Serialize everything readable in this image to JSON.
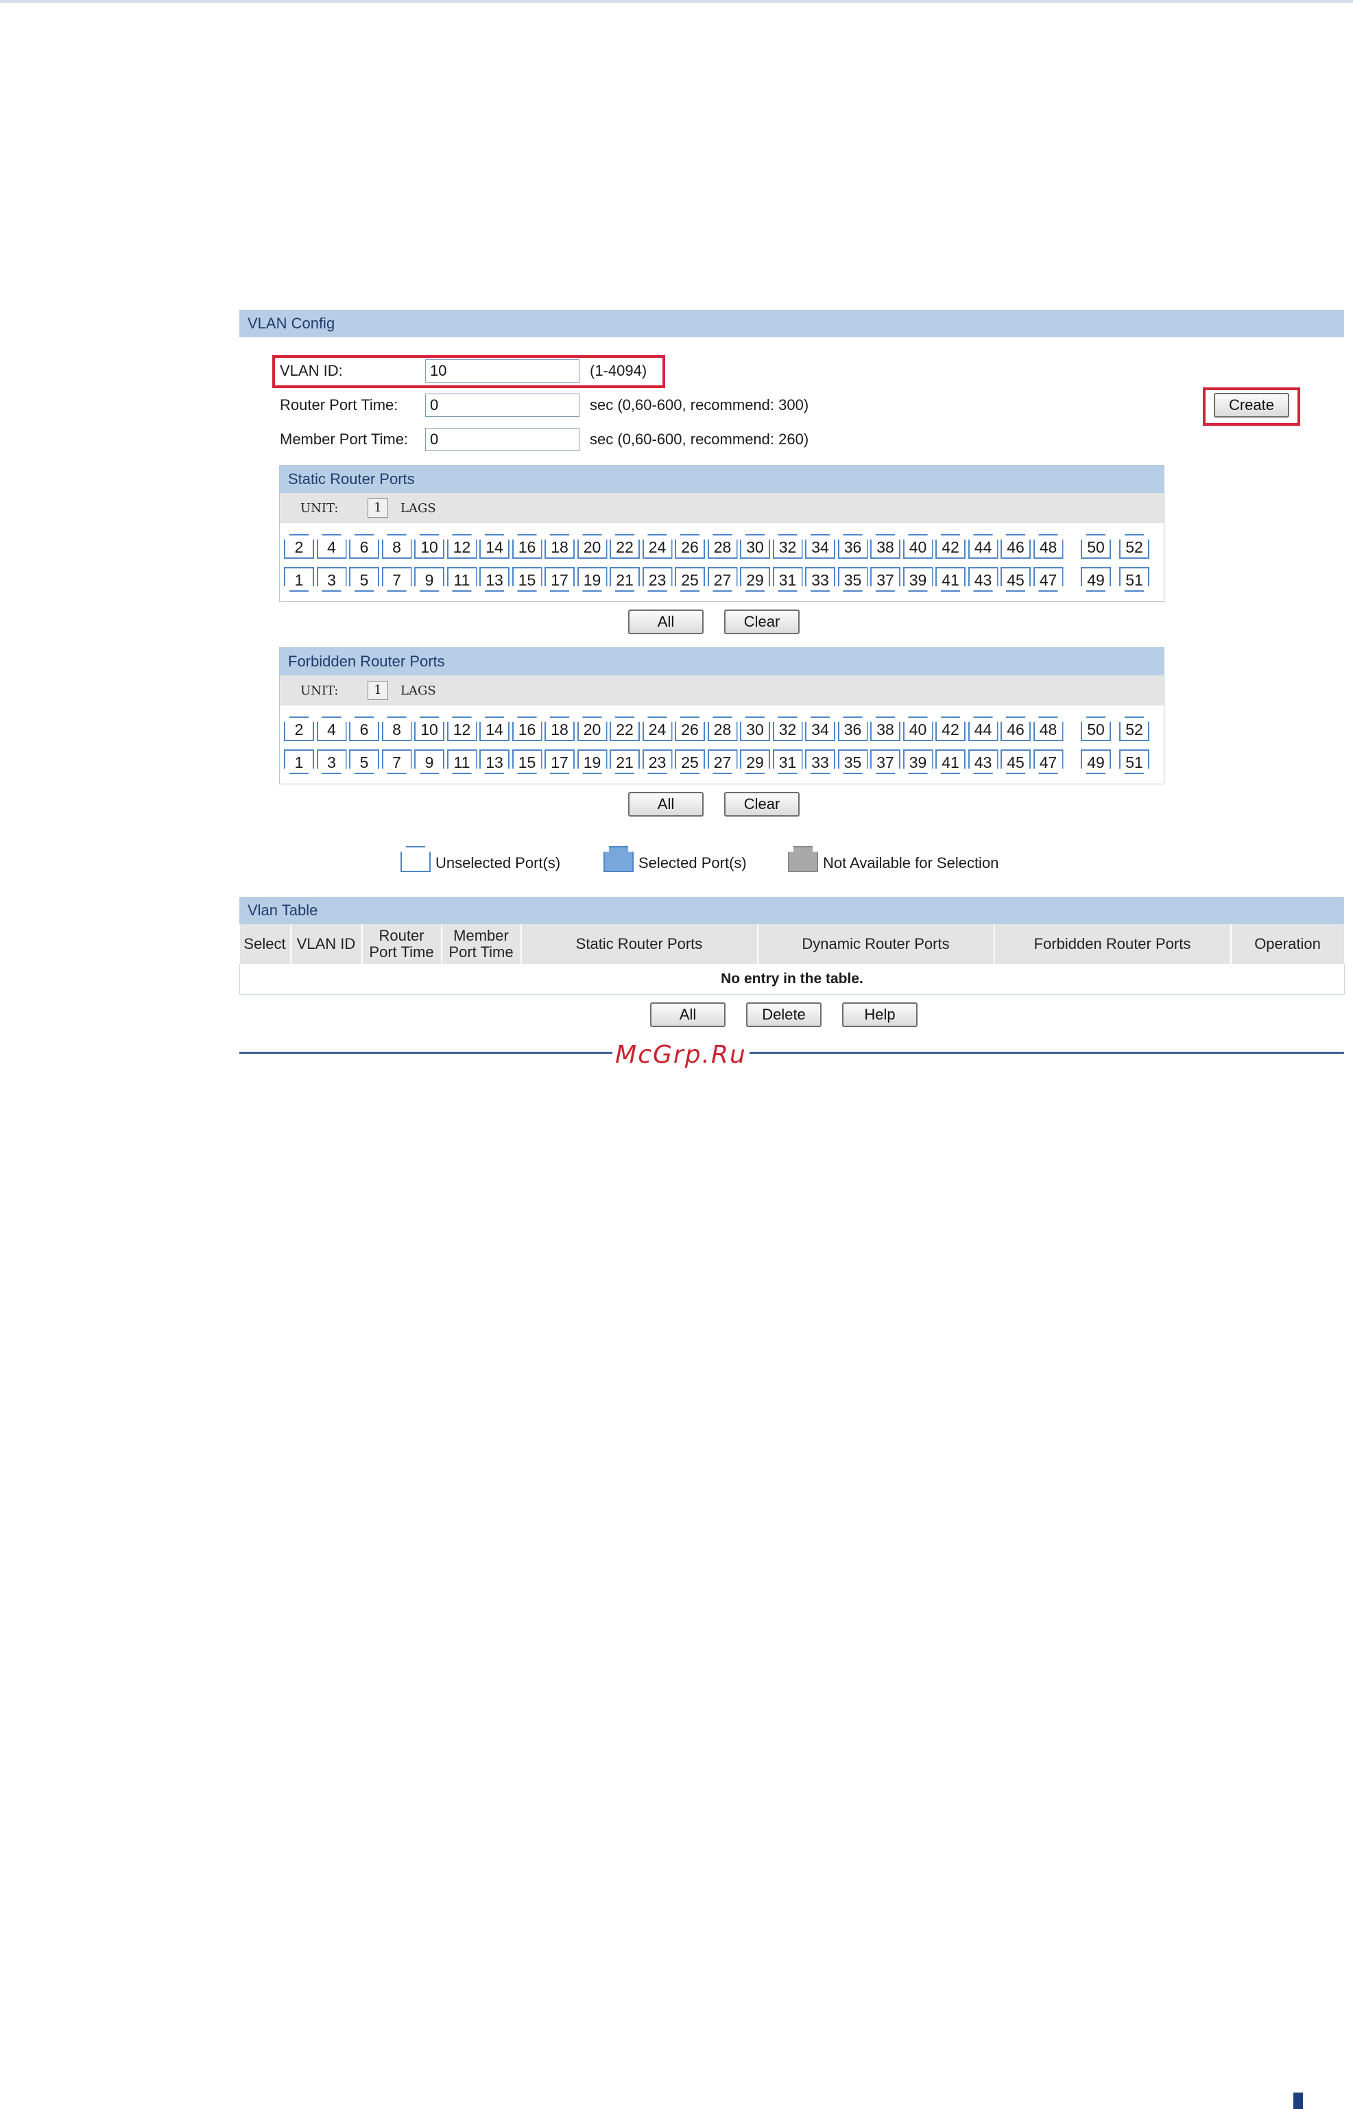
{
  "config_panel": {
    "title": "VLAN Config",
    "vlan_id_label": "VLAN ID:",
    "vlan_id_value": "10",
    "vlan_id_hint": "(1-4094)",
    "router_port_time_label": "Router Port Time:",
    "router_port_time_value": "0",
    "router_port_time_hint": "sec (0,60-600, recommend: 300)",
    "member_port_time_label": "Member Port Time:",
    "member_port_time_value": "0",
    "member_port_time_hint": "sec (0,60-600, recommend: 260)",
    "create_label": "Create"
  },
  "static_router_ports": {
    "title": "Static Router Ports",
    "unit_label": "UNIT:",
    "unit_number": "1",
    "lags_label": "LAGS",
    "all_label": "All",
    "clear_label": "Clear"
  },
  "forbidden_router_ports": {
    "title": "Forbidden Router Ports",
    "unit_label": "UNIT:",
    "unit_number": "1",
    "lags_label": "LAGS",
    "all_label": "All",
    "clear_label": "Clear"
  },
  "ports": {
    "top": [
      "2",
      "4",
      "6",
      "8",
      "10",
      "12",
      "14",
      "16",
      "18",
      "20",
      "22",
      "24",
      "26",
      "28",
      "30",
      "32",
      "34",
      "36",
      "38",
      "40",
      "42",
      "44",
      "46",
      "48",
      "50",
      "52"
    ],
    "bottom": [
      "1",
      "3",
      "5",
      "7",
      "9",
      "11",
      "13",
      "15",
      "17",
      "19",
      "21",
      "23",
      "25",
      "27",
      "29",
      "31",
      "33",
      "35",
      "37",
      "39",
      "41",
      "43",
      "45",
      "47",
      "49",
      "51"
    ]
  },
  "legend": {
    "unselected": "Unselected Port(s)",
    "selected": "Selected Port(s)",
    "unavailable": "Not Available for Selection"
  },
  "vlan_table": {
    "title": "Vlan Table",
    "col_select": "Select",
    "col_vlan_id": "VLAN ID",
    "col_router_port_time_1": "Router",
    "col_router_port_time_2": "Port Time",
    "col_member_port_time_1": "Member",
    "col_member_port_time_2": "Port Time",
    "col_static_router_ports": "Static Router Ports",
    "col_dynamic_router_ports": "Dynamic Router Ports",
    "col_forbidden_router_ports": "Forbidden Router Ports",
    "col_operation": "Operation",
    "empty_message": "No entry in the table.",
    "all_label": "All",
    "delete_label": "Delete",
    "help_label": "Help"
  },
  "watermark": "McGrp.Ru",
  "colors": {
    "header_blue": "#b8cde6",
    "port_border": "#4f86c6",
    "highlight_red": "#d6243a",
    "rule_blue": "#3d5f93"
  }
}
